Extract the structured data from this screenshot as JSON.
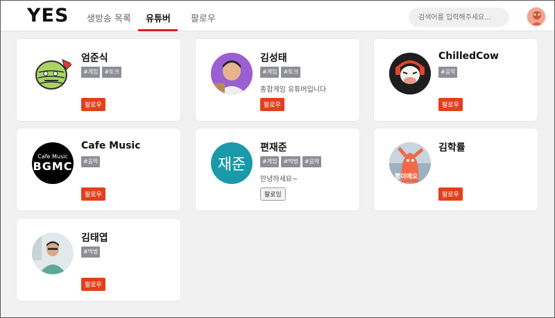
{
  "header": {
    "logo": "YES",
    "tabs": [
      {
        "label": "생방송 목록",
        "active": false
      },
      {
        "label": "유튜버",
        "active": true
      },
      {
        "label": "팔로우",
        "active": false
      }
    ],
    "search_placeholder": "검색어를 입력해주세요..."
  },
  "youtubers": [
    {
      "name": "엄준식",
      "tags": [
        "#게임",
        "#토크"
      ],
      "description": "",
      "button": "팔로우",
      "following": false
    },
    {
      "name": "김성태",
      "tags": [
        "#게임",
        "#토크"
      ],
      "description": "종합게임 유튜버입니다",
      "button": "팔로우",
      "following": false
    },
    {
      "name": "ChilledCow",
      "tags": [
        "#음악"
      ],
      "description": "",
      "button": "팔로우",
      "following": false
    },
    {
      "name": "Cafe Music",
      "tags": [
        "#음악"
      ],
      "description": "",
      "button": "팔로우",
      "following": false,
      "avatar_text": [
        "Cafe Music",
        "BGMC"
      ]
    },
    {
      "name": "편재준",
      "tags": [
        "#게임",
        "#먹방",
        "#음악"
      ],
      "description": "안녕하세요~",
      "button": "팔로잉",
      "following": true,
      "avatar_text": [
        "재준"
      ]
    },
    {
      "name": "김학률",
      "tags": [],
      "description": "",
      "button": "팔로우",
      "following": false,
      "avatar_text": [
        "뿡이에요"
      ]
    },
    {
      "name": "김태엽",
      "tags": [
        "#먹방"
      ],
      "description": "",
      "button": "팔로우",
      "following": false
    }
  ],
  "colors": {
    "accent": "#e11d1d",
    "follow_button": "#e2401b",
    "tag": "#8e8e97",
    "teal_avatar": "#1a9aa8"
  }
}
